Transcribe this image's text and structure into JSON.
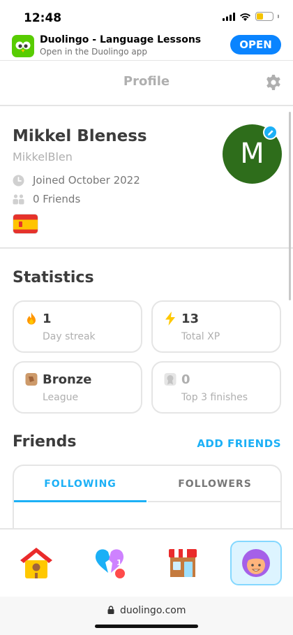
{
  "status_bar": {
    "time": "12:48"
  },
  "banner": {
    "title": "Duolingo - Language Lessons",
    "subtitle": "Open in the Duolingo app",
    "open_label": "OPEN"
  },
  "header": {
    "title": "Profile"
  },
  "profile": {
    "name": "Mikkel Bleness",
    "username": "MikkelBlen",
    "joined": "Joined October 2022",
    "friends": "0 Friends",
    "avatar_letter": "M",
    "avatar_color": "#2e6d1b"
  },
  "statistics": {
    "title": "Statistics",
    "cards": [
      {
        "icon": "flame-icon",
        "value": "1",
        "label": "Day streak"
      },
      {
        "icon": "lightning-icon",
        "value": "13",
        "label": "Total XP"
      },
      {
        "icon": "bronze-league-icon",
        "value": "Bronze",
        "label": "League"
      },
      {
        "icon": "medal-icon",
        "value": "0",
        "label": "Top 3 finishes"
      }
    ]
  },
  "friends": {
    "title": "Friends",
    "add_label": "ADD FRIENDS",
    "tabs": [
      "FOLLOWING",
      "FOLLOWERS"
    ]
  },
  "tabbar": {
    "items": [
      "home-icon",
      "broken-heart-icon",
      "shop-icon",
      "profile-icon"
    ],
    "badge": "1",
    "accent": "#1cb0f6"
  },
  "browser": {
    "url": "duolingo.com"
  }
}
